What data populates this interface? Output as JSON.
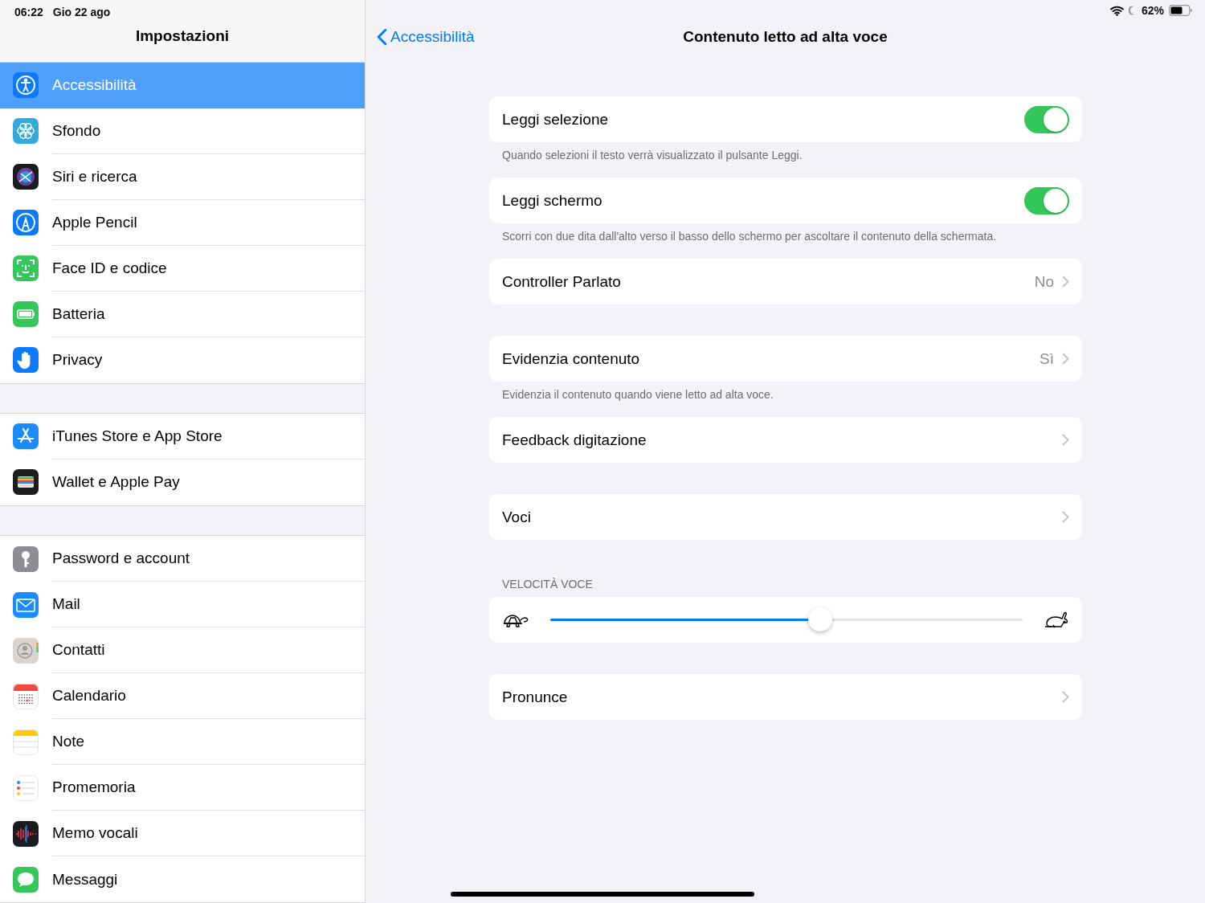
{
  "status_bar": {
    "time": "06:22",
    "date": "Gio 22 ago",
    "battery_text": "62%"
  },
  "sidebar": {
    "title": "Impostazioni",
    "groups": [
      [
        {
          "label": "Accessibilità",
          "selected": true
        },
        {
          "label": "Sfondo",
          "selected": false
        },
        {
          "label": "Siri e ricerca",
          "selected": false
        },
        {
          "label": "Apple Pencil",
          "selected": false
        },
        {
          "label": "Face ID e codice",
          "selected": false
        },
        {
          "label": "Batteria",
          "selected": false
        },
        {
          "label": "Privacy",
          "selected": false
        }
      ],
      [
        {
          "label": "iTunes Store e App Store",
          "selected": false
        },
        {
          "label": "Wallet e Apple Pay",
          "selected": false
        }
      ],
      [
        {
          "label": "Password e account",
          "selected": false
        },
        {
          "label": "Mail",
          "selected": false
        },
        {
          "label": "Contatti",
          "selected": false
        },
        {
          "label": "Calendario",
          "selected": false
        },
        {
          "label": "Note",
          "selected": false
        },
        {
          "label": "Promemoria",
          "selected": false
        },
        {
          "label": "Memo vocali",
          "selected": false
        },
        {
          "label": "Messaggi",
          "selected": false
        }
      ]
    ]
  },
  "main": {
    "back": "Accessibilità",
    "title": "Contenuto letto ad alta voce",
    "items": [
      {
        "kind": "toggle",
        "label": "Leggi selezione",
        "on": true,
        "footer": "Quando selezioni il testo verrà visualizzato il pulsante Leggi."
      },
      {
        "kind": "toggle",
        "label": "Leggi schermo",
        "on": true,
        "footer": "Scorri con due dita dall'alto verso il basso dello schermo per ascoltare il contenuto della schermata."
      },
      {
        "kind": "disclosure",
        "label": "Controller Parlato",
        "value": "No"
      },
      {
        "kind": "disclosure",
        "label": "Evidenzia contenuto",
        "value": "Sì",
        "footer": "Evidenzia il contenuto quando viene letto ad alta voce."
      },
      {
        "kind": "disclosure",
        "label": "Feedback digitazione"
      },
      {
        "kind": "disclosure",
        "label": "Voci"
      },
      {
        "kind": "slider",
        "header": "VELOCITÀ VOCE",
        "level": 0.571
      },
      {
        "kind": "disclosure",
        "label": "Pronunce"
      }
    ]
  }
}
